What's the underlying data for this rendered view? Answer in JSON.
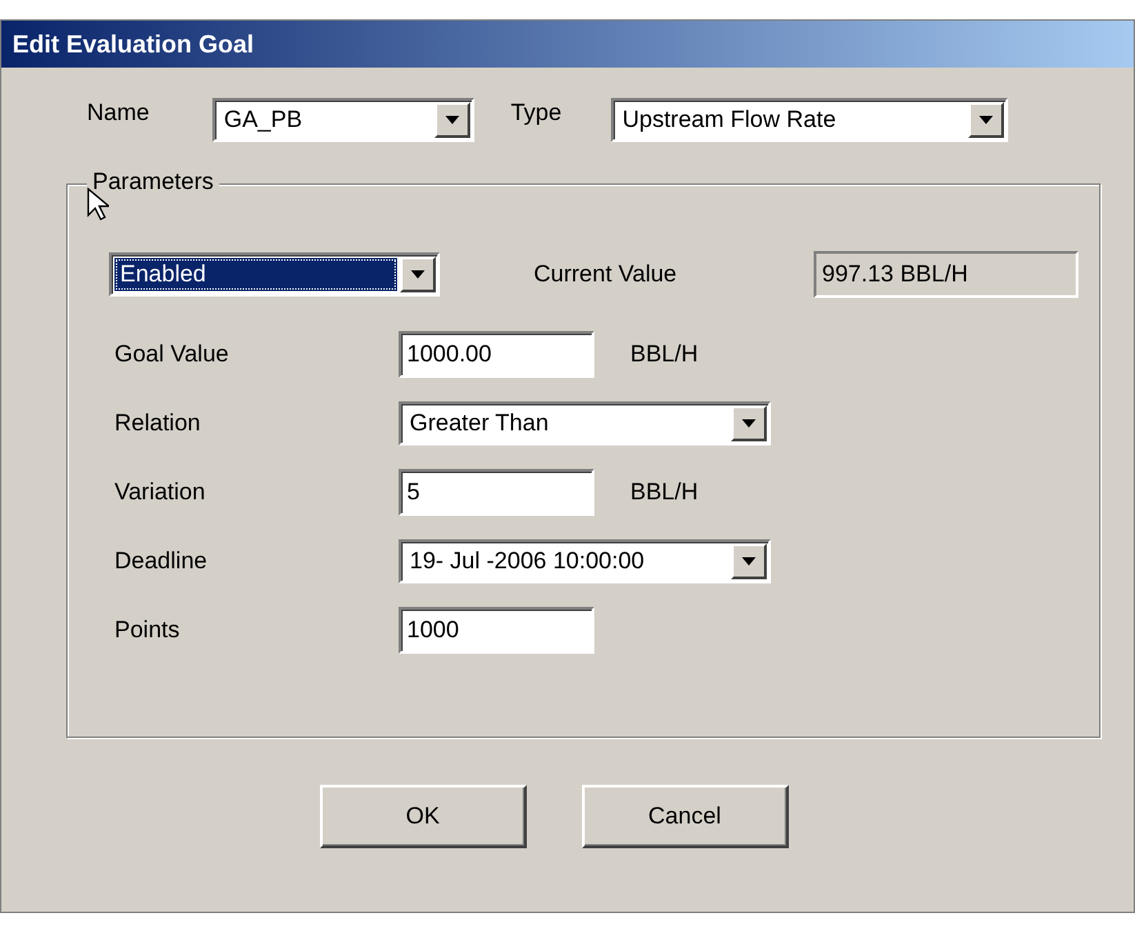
{
  "window": {
    "title": "Edit Evaluation Goal"
  },
  "header_fields": [
    {
      "label": "Name",
      "kind": "combo",
      "value": "GA_PB"
    },
    {
      "label": "Type",
      "kind": "combo",
      "value": "Upstream Flow Rate"
    }
  ],
  "parameters": {
    "title": "Parameters",
    "status": {
      "value": "Enabled",
      "selected": true
    },
    "current_value": {
      "label": "Current Value",
      "value": "997.13 BBL/H"
    },
    "rows": [
      {
        "label": "Goal Value",
        "kind": "text",
        "value": "1000.00",
        "unit": "BBL/H"
      },
      {
        "label": "Relation",
        "kind": "combo",
        "value": "Greater Than"
      },
      {
        "label": "Variation",
        "kind": "text",
        "value": "5",
        "unit": "BBL/H"
      },
      {
        "label": "Deadline",
        "kind": "combo",
        "value": "19- Jul -2006 10:00:00"
      },
      {
        "label": "Points",
        "kind": "text",
        "value": "1000"
      }
    ]
  },
  "buttons": [
    "OK",
    "Cancel"
  ]
}
